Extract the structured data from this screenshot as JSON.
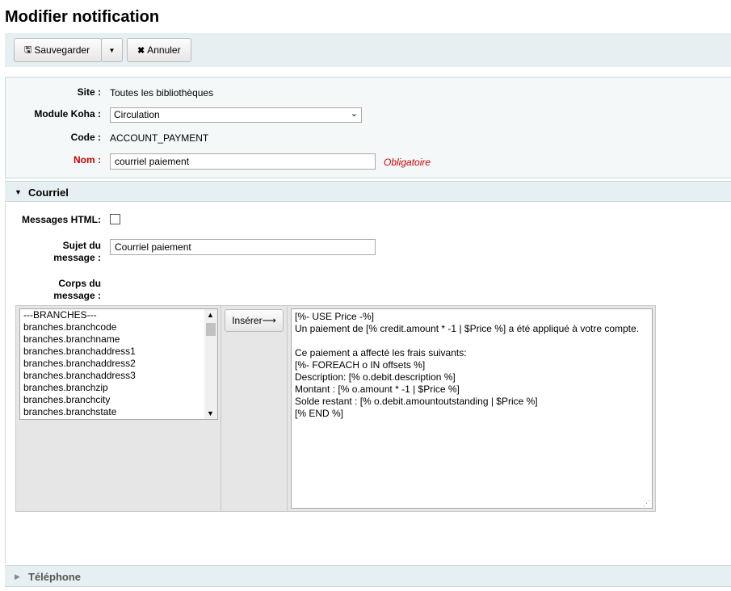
{
  "page": {
    "title": "Modifier notification"
  },
  "toolbar": {
    "save_label": "Sauvegarder",
    "cancel_label": "Annuler"
  },
  "form": {
    "site_label": "Site :",
    "site_value": "Toutes les bibliothèques",
    "module_label": "Module Koha :",
    "module_value": "Circulation",
    "code_label": "Code :",
    "code_value": "ACCOUNT_PAYMENT",
    "name_label": "Nom :",
    "name_value": "courriel paiement",
    "required_text": "Obligatoire"
  },
  "email_section": {
    "title": "Courriel",
    "html_label": "Messages HTML:",
    "subject_label_1": "Sujet du",
    "subject_label_2": "message :",
    "subject_value": "Courriel paiement",
    "body_label_1": "Corps du",
    "body_label_2": "message :",
    "insert_button": "Insérer⟶",
    "fields": [
      "---BRANCHES---",
      "branches.branchcode",
      "branches.branchname",
      "branches.branchaddress1",
      "branches.branchaddress2",
      "branches.branchaddress3",
      "branches.branchzip",
      "branches.branchcity",
      "branches.branchstate"
    ],
    "body_lines": [
      "[%- USE Price -%]",
      "Un paiement de [% credit.amount * -1 | $Price %] a été appliqué à votre compte.",
      "",
      "Ce paiement a affecté les frais suivants:",
      "[%- FOREACH o IN offsets %]",
      "Description: [% o.debit.description %]",
      "Montant : [% o.amount * -1 | $Price %]",
      "Solde restant : [% o.debit.amountoutstanding | $Price %]",
      "[% END %]"
    ]
  },
  "phone_section": {
    "title": "Téléphone"
  },
  "icons": {
    "save": "floppy-icon",
    "cancel": "x-icon",
    "dropdown": "caret-down-icon"
  }
}
